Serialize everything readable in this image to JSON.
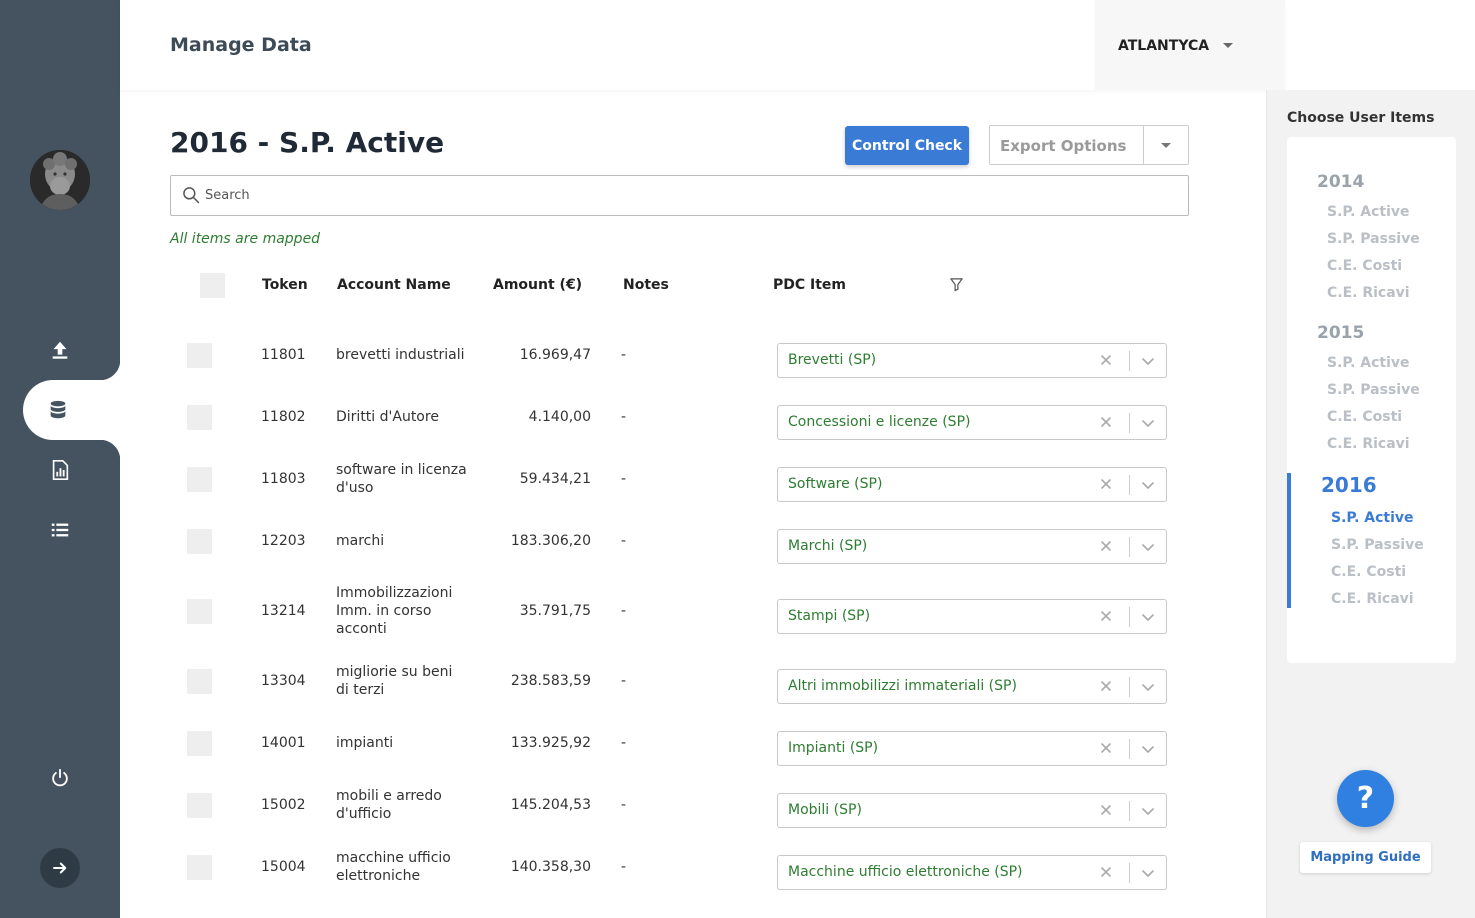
{
  "header": {
    "title": "Manage Data",
    "user": "ATLANTYCA"
  },
  "page": {
    "title": "2016 - S.P. Active",
    "control_check": "Control Check",
    "export_options": "Export Options",
    "search_placeholder": "Search",
    "mapped_message": "All items are mapped"
  },
  "table": {
    "columns": [
      "Token",
      "Account Name",
      "Amount (€)",
      "Notes",
      "PDC Item"
    ],
    "rows": [
      {
        "token": "11801",
        "account": [
          "brevetti industriali"
        ],
        "amount": "16.969,47",
        "notes": "-",
        "pdc": "Brevetti (SP)"
      },
      {
        "token": "11802",
        "account": [
          "Diritti d'Autore"
        ],
        "amount": "4.140,00",
        "notes": "-",
        "pdc": "Concessioni e licenze (SP)"
      },
      {
        "token": "11803",
        "account": [
          "software in licenza",
          "d'uso"
        ],
        "amount": "59.434,21",
        "notes": "-",
        "pdc": "Software (SP)"
      },
      {
        "token": "12203",
        "account": [
          "marchi"
        ],
        "amount": "183.306,20",
        "notes": "-",
        "pdc": "Marchi (SP)"
      },
      {
        "token": "13214",
        "account": [
          "Immobilizzazioni",
          "Imm. in corso",
          "acconti"
        ],
        "amount": "35.791,75",
        "notes": "-",
        "pdc": "Stampi (SP)"
      },
      {
        "token": "13304",
        "account": [
          "migliorie su beni",
          "di terzi"
        ],
        "amount": "238.583,59",
        "notes": "-",
        "pdc": "Altri immobilizzi immateriali (SP)"
      },
      {
        "token": "14001",
        "account": [
          "impianti"
        ],
        "amount": "133.925,92",
        "notes": "-",
        "pdc": "Impianti (SP)"
      },
      {
        "token": "15002",
        "account": [
          "mobili e arredo",
          "d'ufficio"
        ],
        "amount": "145.204,53",
        "notes": "-",
        "pdc": "Mobili (SP)"
      },
      {
        "token": "15004",
        "account": [
          "macchine ufficio",
          "elettroniche"
        ],
        "amount": "140.358,30",
        "notes": "-",
        "pdc": "Macchine ufficio elettroniche (SP)"
      }
    ]
  },
  "user_items": {
    "title": "Choose User Items",
    "years": [
      {
        "year": "2014",
        "items": [
          "S.P. Active",
          "S.P. Passive",
          "C.E. Costi",
          "C.E. Ricavi"
        ]
      },
      {
        "year": "2015",
        "items": [
          "S.P. Active",
          "S.P. Passive",
          "C.E. Costi",
          "C.E. Ricavi"
        ]
      },
      {
        "year": "2016",
        "items": [
          "S.P. Active",
          "S.P. Passive",
          "C.E. Costi",
          "C.E. Ricavi"
        ],
        "active": true,
        "active_item": "S.P. Active"
      }
    ]
  },
  "help": {
    "symbol": "?",
    "guide_label": "Mapping Guide"
  },
  "colors": {
    "sidebar": "#44535f",
    "accent": "#3a7bd5",
    "mapped": "#2e7d32"
  },
  "icons": [
    "upload-icon",
    "database-icon",
    "report-icon",
    "list-icon",
    "power-icon",
    "arrow-right-icon",
    "search-icon",
    "filter-icon",
    "clear-icon",
    "chevron-down-icon"
  ]
}
